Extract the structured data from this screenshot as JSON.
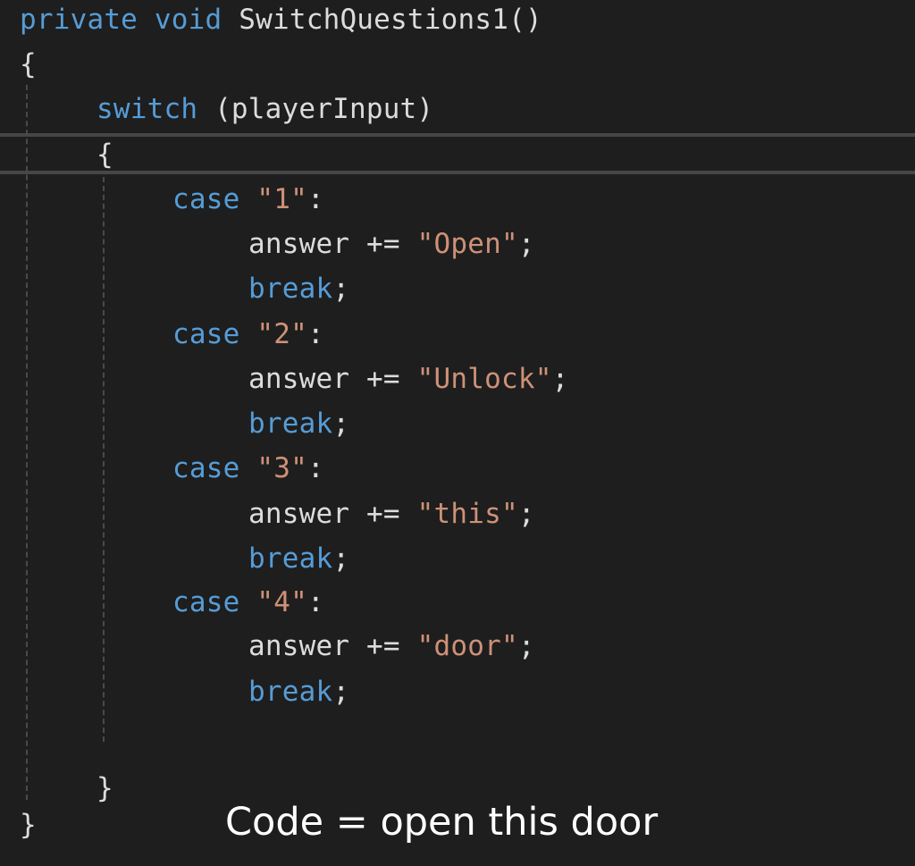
{
  "code": {
    "signature": {
      "modifier": "private",
      "return_type": "void",
      "method": "SwitchQuestions1()"
    },
    "open_brace": "{",
    "close_brace": "}",
    "switch_keyword": "switch",
    "switch_expr": "(playerInput)",
    "switch_open_brace": "{",
    "switch_close_brace": "}",
    "cases": [
      {
        "keyword": "case",
        "label": "\"1\"",
        "colon": ":",
        "target": "answer +=",
        "value": "\"Open\"",
        "semicolon": ";",
        "break": "break",
        "break_semicolon": ";"
      },
      {
        "keyword": "case",
        "label": "\"2\"",
        "colon": ":",
        "target": "answer +=",
        "value": "\"Unlock\"",
        "semicolon": ";",
        "break": "break",
        "break_semicolon": ";"
      },
      {
        "keyword": "case",
        "label": "\"3\"",
        "colon": ":",
        "target": "answer +=",
        "value": "\"this\"",
        "semicolon": ";",
        "break": "break",
        "break_semicolon": ";"
      },
      {
        "keyword": "case",
        "label": "\"4\"",
        "colon": ":",
        "target": "answer +=",
        "value": "\"door\"",
        "semicolon": ";",
        "break": "break",
        "break_semicolon": ";"
      }
    ]
  },
  "caption": "Code = open this door",
  "colors": {
    "background": "#1e1e1e",
    "keyword": "#569cd6",
    "string": "#ce9178",
    "text": "#dcdcdc"
  }
}
